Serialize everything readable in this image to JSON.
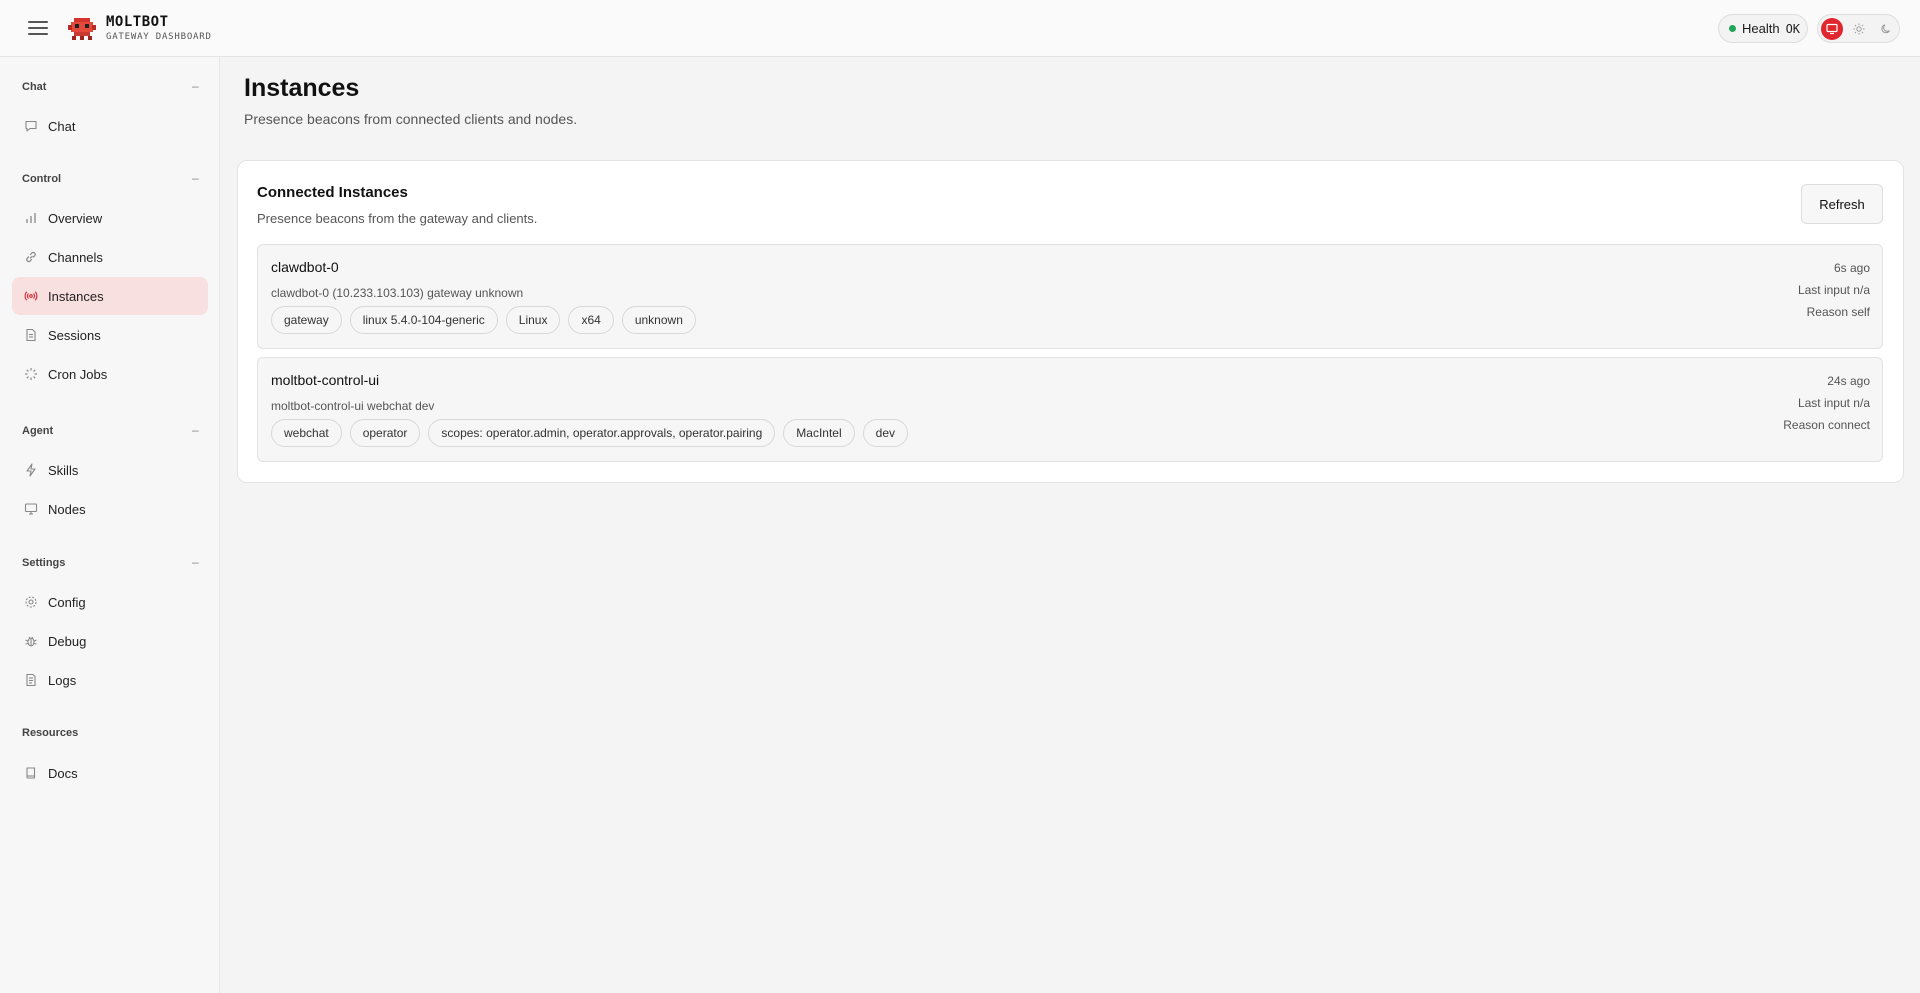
{
  "brand": {
    "name": "MOLTBOT",
    "subtitle": "GATEWAY DASHBOARD"
  },
  "health": {
    "label": "Health",
    "status": "OK",
    "status_color": "#22a35a"
  },
  "theme": {
    "options": [
      "system",
      "light",
      "dark"
    ],
    "active": "system",
    "accent": "#e0262e"
  },
  "sidebar": {
    "groups": [
      {
        "title": "Chat",
        "collapse": "–",
        "items": [
          {
            "label": "Chat",
            "icon": "chat-bubble-icon"
          }
        ]
      },
      {
        "title": "Control",
        "collapse": "–",
        "items": [
          {
            "label": "Overview",
            "icon": "bar-chart-icon"
          },
          {
            "label": "Channels",
            "icon": "link-icon"
          },
          {
            "label": "Instances",
            "icon": "broadcast-icon",
            "active": true
          },
          {
            "label": "Sessions",
            "icon": "document-icon"
          },
          {
            "label": "Cron Jobs",
            "icon": "loader-icon"
          }
        ]
      },
      {
        "title": "Agent",
        "collapse": "–",
        "items": [
          {
            "label": "Skills",
            "icon": "lightning-icon"
          },
          {
            "label": "Nodes",
            "icon": "monitor-icon"
          }
        ]
      },
      {
        "title": "Settings",
        "collapse": "–",
        "items": [
          {
            "label": "Config",
            "icon": "gear-icon"
          },
          {
            "label": "Debug",
            "icon": "bug-icon"
          },
          {
            "label": "Logs",
            "icon": "file-text-icon"
          }
        ]
      },
      {
        "title": "Resources",
        "items": [
          {
            "label": "Docs",
            "icon": "book-icon"
          }
        ]
      }
    ]
  },
  "page": {
    "title": "Instances",
    "subtitle": "Presence beacons from connected clients and nodes."
  },
  "card": {
    "title": "Connected Instances",
    "subtitle": "Presence beacons from the gateway and clients.",
    "refresh_label": "Refresh",
    "instances": [
      {
        "name": "clawdbot-0",
        "description": "clawdbot-0 (10.233.103.103) gateway unknown",
        "tags": [
          "gateway",
          "linux 5.4.0-104-generic",
          "Linux",
          "x64",
          "unknown"
        ],
        "age": "6s ago",
        "last_input": "Last input n/a",
        "reason": "Reason self"
      },
      {
        "name": "moltbot-control-ui",
        "description": "moltbot-control-ui webchat dev",
        "tags": [
          "webchat",
          "operator",
          "scopes: operator.admin, operator.approvals, operator.pairing",
          "MacIntel",
          "dev"
        ],
        "age": "24s ago",
        "last_input": "Last input n/a",
        "reason": "Reason connect"
      }
    ]
  }
}
